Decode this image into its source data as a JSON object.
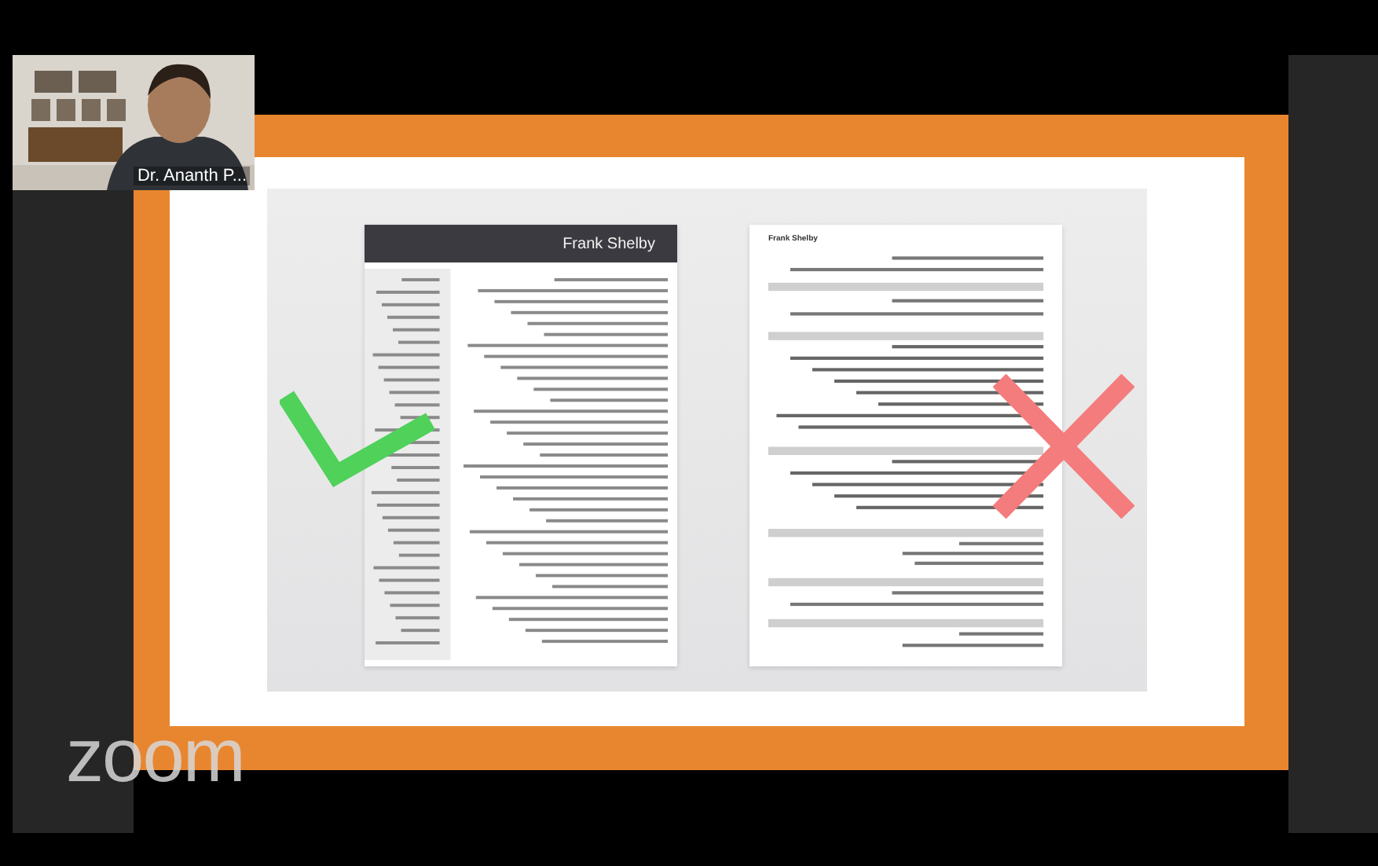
{
  "video_tile": {
    "name_label": "Dr. Ananth P..."
  },
  "shared_slide": {
    "resumes": [
      {
        "kind": "dark_header",
        "name": "Frank Shelby"
      },
      {
        "kind": "plain",
        "name": "Frank Shelby"
      }
    ],
    "marks": [
      {
        "kind": "check"
      },
      {
        "kind": "cross"
      }
    ]
  },
  "logo": "zoom"
}
